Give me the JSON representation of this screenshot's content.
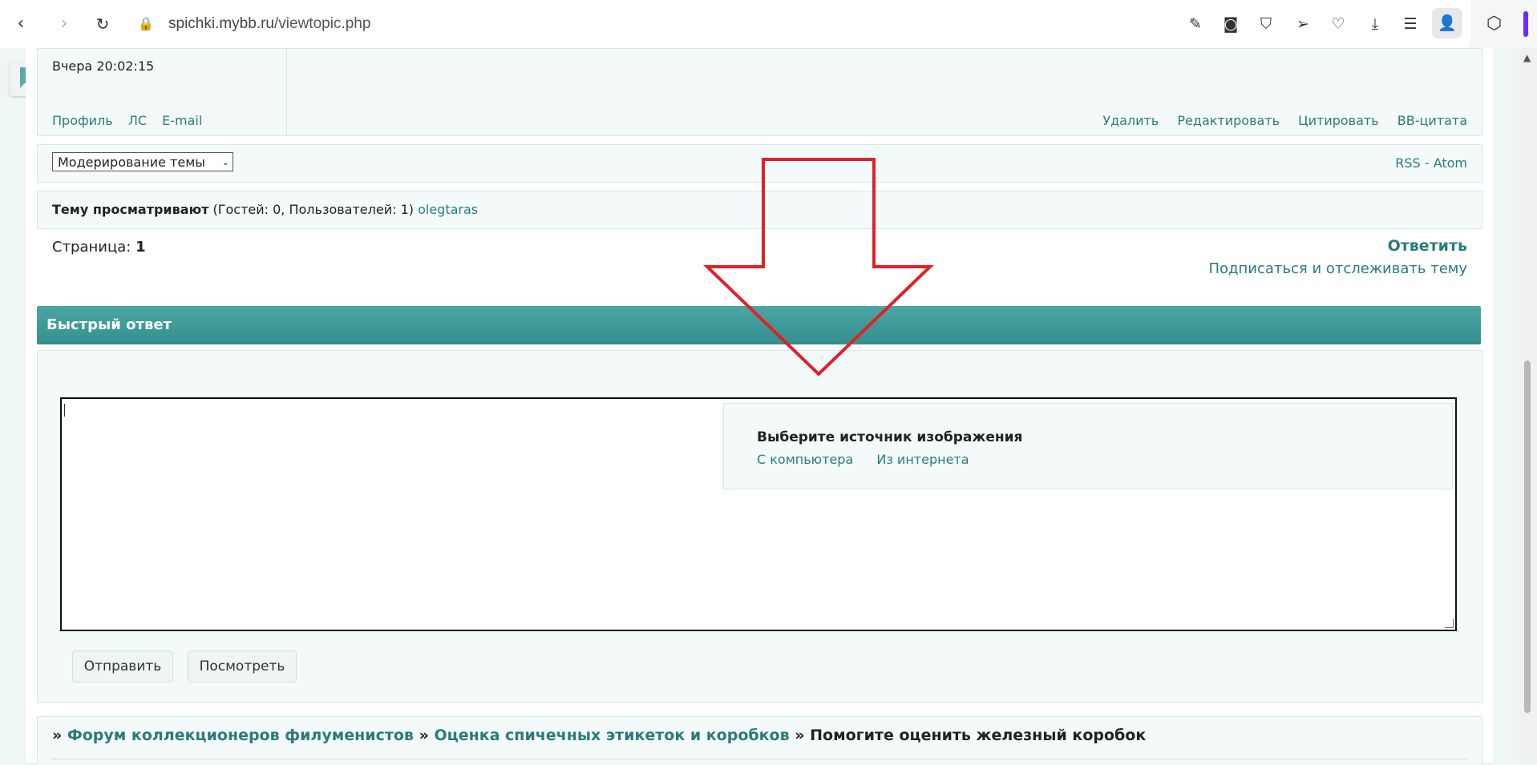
{
  "browser": {
    "url_domain": "spichki.mybb.ru",
    "url_path": "/viewtopic.php"
  },
  "post": {
    "time": "Вчера 20:02:15",
    "profile_links": [
      "Профиль",
      "ЛС",
      "E-mail"
    ],
    "actions": [
      "Удалить",
      "Редактировать",
      "Цитировать",
      "BB-цитата"
    ]
  },
  "moderation": {
    "select_value": "Модерирование темы",
    "rss": "RSS",
    "sep": "-",
    "atom": "Atom"
  },
  "viewers": {
    "label": "Тему просматривают",
    "counts": "(Гостей: 0, Пользователей: 1)",
    "user": "olegtaras"
  },
  "paging": {
    "label": "Страница:",
    "number": "1",
    "reply": "Ответить",
    "subscribe": "Подписаться и отслеживать тему"
  },
  "quick_reply": {
    "title": "Быстрый ответ",
    "image_popup": {
      "title": "Выберите источник изображения",
      "from_computer": "С компьютера",
      "from_internet": "Из интернета"
    },
    "submit": "Отправить",
    "preview": "Посмотреть"
  },
  "toolbar_icons": [
    "font-icon",
    "size-icon",
    "bold-icon",
    "italic-icon",
    "underline-icon",
    "strike-icon",
    "align-left-icon",
    "align-center-icon",
    "align-right-icon",
    "link-icon",
    "book-icon",
    "image-icon",
    "video-icon",
    "lock-icon",
    "quote-icon",
    "code-icon",
    "color-icon",
    "table-icon",
    "smile-icon",
    "keyboard-icon",
    "more-icon"
  ],
  "breadcrumb": {
    "sep": "»",
    "items": [
      "Форум коллекционеров филуменистов",
      "Оценка спичечных этикеток и коробков"
    ],
    "current": "Помогите оценить железный коробок"
  },
  "colors": {
    "header_bar": "#3d9a98",
    "link": "#2a7b7b",
    "annotation_arrow": "#e0202a"
  }
}
